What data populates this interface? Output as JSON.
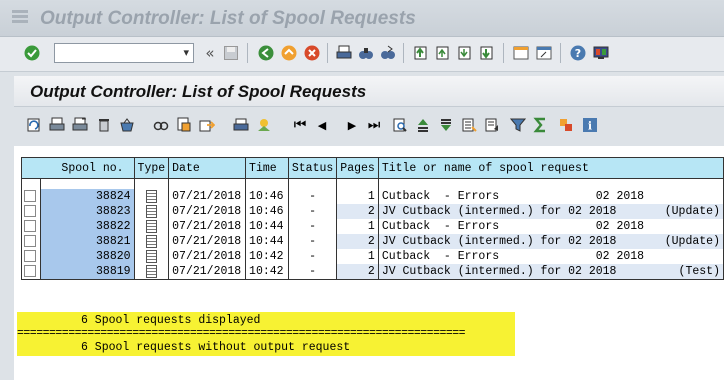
{
  "window": {
    "title": "Output Controller: List of Spool Requests"
  },
  "page": {
    "title": "Output Controller: List of Spool Requests"
  },
  "toolbar": {
    "command_field_value": "",
    "back_glyph": "«"
  },
  "table": {
    "headers": [
      "Spool no.",
      "Type",
      "Date",
      "Time",
      "Status",
      "Pages",
      "Title or name of spool request"
    ],
    "rows": [
      {
        "spool_no": "38824",
        "date": "07/21/2018",
        "time": "10:46",
        "status": "-",
        "pages": "1",
        "title": "Cutback  - Errors              02 2018"
      },
      {
        "spool_no": "38823",
        "date": "07/21/2018",
        "time": "10:46",
        "status": "-",
        "pages": "2",
        "title": "JV Cutback (intermed.) for 02 2018       (Update)"
      },
      {
        "spool_no": "38822",
        "date": "07/21/2018",
        "time": "10:44",
        "status": "-",
        "pages": "1",
        "title": "Cutback  - Errors              02 2018"
      },
      {
        "spool_no": "38821",
        "date": "07/21/2018",
        "time": "10:44",
        "status": "-",
        "pages": "2",
        "title": "JV Cutback (intermed.) for 02 2018       (Update)"
      },
      {
        "spool_no": "38820",
        "date": "07/21/2018",
        "time": "10:42",
        "status": "-",
        "pages": "1",
        "title": "Cutback  - Errors              02 2018"
      },
      {
        "spool_no": "38819",
        "date": "07/21/2018",
        "time": "10:42",
        "status": "-",
        "pages": "2",
        "title": "JV Cutback (intermed.) for 02 2018         (Test)"
      }
    ]
  },
  "messages": {
    "line1": "6 Spool requests displayed",
    "separator": "======================================================================",
    "line2": "6 Spool requests without output request"
  },
  "colors": {
    "header_bg": "#b7e6f5",
    "spool_no_bg": "#a8c8ec",
    "message_bg": "#f7f233"
  }
}
